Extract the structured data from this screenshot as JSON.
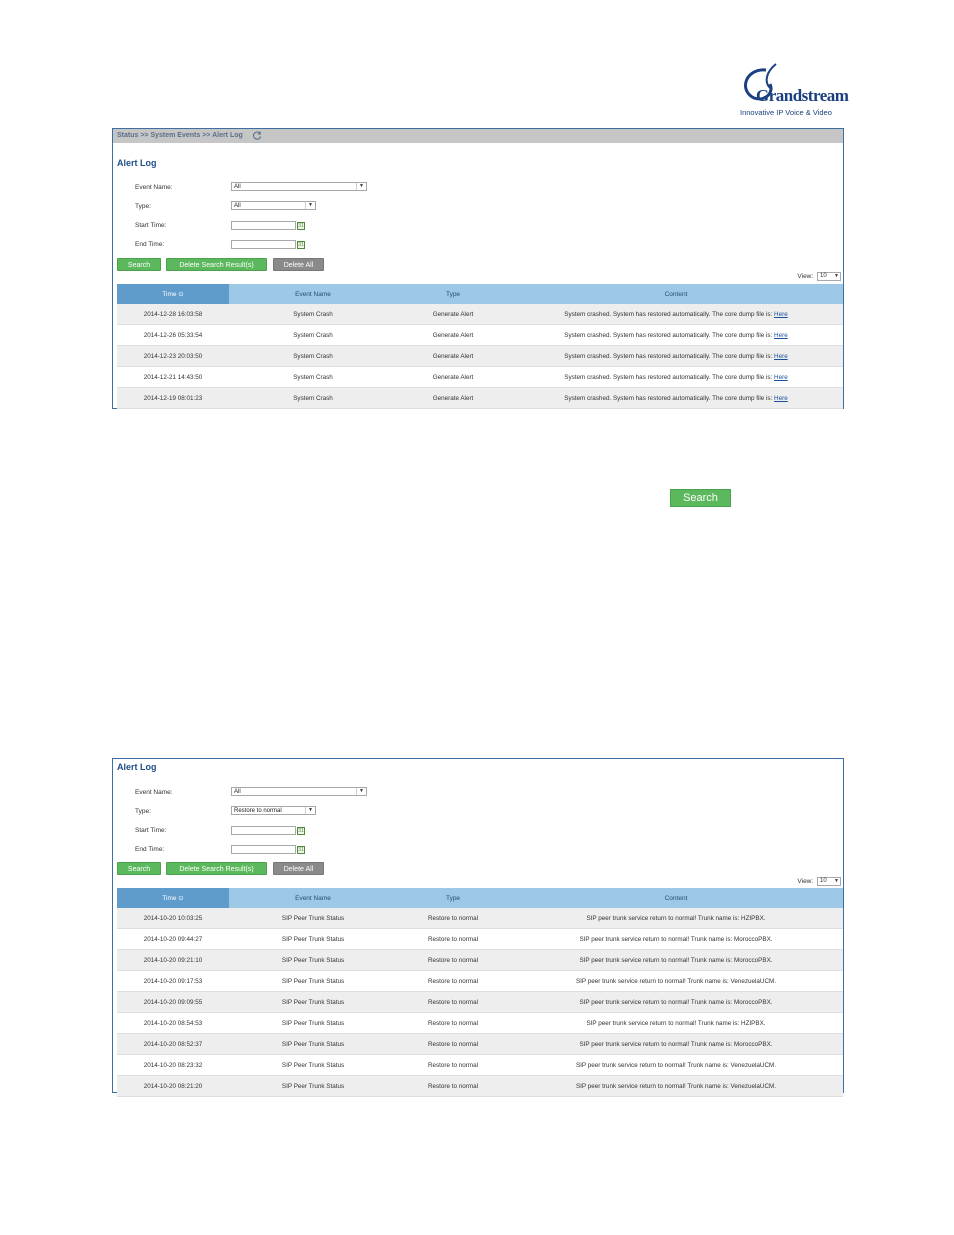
{
  "logo": {
    "brand": "Grandstream",
    "tagline": "Innovative IP Voice & Video"
  },
  "panel1": {
    "breadcrumb": "Status >> System Events >> Alert Log",
    "title": "Alert Log",
    "filters": {
      "event_name_label": "Event Name:",
      "event_name_value": "All",
      "type_label": "Type:",
      "type_value": "All",
      "start_time_label": "Start Time:",
      "end_time_label": "End Time:"
    },
    "buttons": {
      "search": "Search",
      "delete_results": "Delete Search Result(s)",
      "delete_all": "Delete All"
    },
    "view_label": "View:",
    "view_value": "10",
    "columns": [
      "Time",
      "Event Name",
      "Type",
      "Content"
    ],
    "rows": [
      {
        "time": "2014-12-28 16:03:58",
        "event": "System Crash",
        "type": "Generate Alert",
        "content": "System crashed. System has restored automatically. The core dump file is:",
        "link": "Here"
      },
      {
        "time": "2014-12-26 05:33:54",
        "event": "System Crash",
        "type": "Generate Alert",
        "content": "System crashed. System has restored automatically. The core dump file is:",
        "link": "Here"
      },
      {
        "time": "2014-12-23 20:03:50",
        "event": "System Crash",
        "type": "Generate Alert",
        "content": "System crashed. System has restored automatically. The core dump file is:",
        "link": "Here"
      },
      {
        "time": "2014-12-21 14:43:50",
        "event": "System Crash",
        "type": "Generate Alert",
        "content": "System crashed. System has restored automatically. The core dump file is:",
        "link": "Here"
      },
      {
        "time": "2014-12-19 08:01:23",
        "event": "System Crash",
        "type": "Generate Alert",
        "content": "System crashed. System has restored automatically. The core dump file is:",
        "link": "Here"
      }
    ]
  },
  "inline_search_button": "Search",
  "panel2": {
    "title": "Alert Log",
    "filters": {
      "event_name_label": "Event Name:",
      "event_name_value": "All",
      "type_label": "Type:",
      "type_value": "Restore to normal",
      "start_time_label": "Start Time:",
      "end_time_label": "End Time:"
    },
    "buttons": {
      "search": "Search",
      "delete_results": "Delete Search Result(s)",
      "delete_all": "Delete All"
    },
    "view_label": "View:",
    "view_value": "10",
    "columns": [
      "Time",
      "Event Name",
      "Type",
      "Content"
    ],
    "rows": [
      {
        "time": "2014-10-20 10:03:25",
        "event": "SIP Peer Trunk Status",
        "type": "Restore to normal",
        "content": "SIP peer trunk service return to normal! Trunk name is: HZIPBX."
      },
      {
        "time": "2014-10-20 09:44:27",
        "event": "SIP Peer Trunk Status",
        "type": "Restore to normal",
        "content": "SIP peer trunk service return to normal! Trunk name is: MoroccoPBX."
      },
      {
        "time": "2014-10-20 09:21:10",
        "event": "SIP Peer Trunk Status",
        "type": "Restore to normal",
        "content": "SIP peer trunk service return to normal! Trunk name is: MoroccoPBX."
      },
      {
        "time": "2014-10-20 09:17:53",
        "event": "SIP Peer Trunk Status",
        "type": "Restore to normal",
        "content": "SIP peer trunk service return to normal! Trunk name is: VenezuelaUCM."
      },
      {
        "time": "2014-10-20 09:09:55",
        "event": "SIP Peer Trunk Status",
        "type": "Restore to normal",
        "content": "SIP peer trunk service return to normal! Trunk name is: MoroccoPBX."
      },
      {
        "time": "2014-10-20 08:54:53",
        "event": "SIP Peer Trunk Status",
        "type": "Restore to normal",
        "content": "SIP peer trunk service return to normal! Trunk name is: HZIPBX."
      },
      {
        "time": "2014-10-20 08:52:37",
        "event": "SIP Peer Trunk Status",
        "type": "Restore to normal",
        "content": "SIP peer trunk service return to normal! Trunk name is: MoroccoPBX."
      },
      {
        "time": "2014-10-20 08:23:32",
        "event": "SIP Peer Trunk Status",
        "type": "Restore to normal",
        "content": "SIP peer trunk service return to normal! Trunk name is: VenezuelaUCM."
      },
      {
        "time": "2014-10-20 08:21:20",
        "event": "SIP Peer Trunk Status",
        "type": "Restore to normal",
        "content": "SIP peer trunk service return to normal! Trunk name is: VenezuelaUCM."
      }
    ]
  }
}
